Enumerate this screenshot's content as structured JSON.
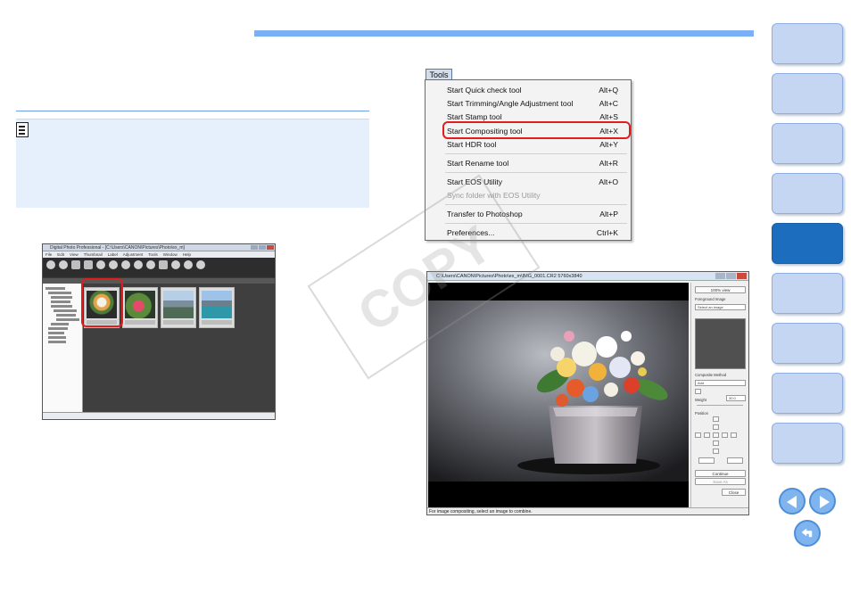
{
  "tools_menu": {
    "tab_label": "Tools",
    "items": [
      {
        "label": "Start Quick check tool",
        "shortcut": "Alt+Q"
      },
      {
        "label": "Start Trimming/Angle Adjustment tool",
        "shortcut": "Alt+C"
      },
      {
        "label": "Start Stamp tool",
        "shortcut": "Alt+S"
      },
      {
        "label": "Start Compositing tool",
        "shortcut": "Alt+X",
        "highlighted": true
      },
      {
        "label": "Start HDR tool",
        "shortcut": "Alt+Y"
      },
      {
        "label": "Start Rename tool",
        "shortcut": "Alt+R"
      },
      {
        "label": "Start EOS Utility",
        "shortcut": "Alt+O"
      },
      {
        "label": "Sync folder with EOS Utility",
        "shortcut": "",
        "disabled": true
      },
      {
        "label": "Transfer to Photoshop",
        "shortcut": "Alt+P"
      },
      {
        "label": "Preferences...",
        "shortcut": "Ctrl+K"
      }
    ]
  },
  "compositing_window": {
    "title": "C:\\Users\\CANON\\Pictures\\Photo\\ex_m\\IMG_0001.CR2  5760x3840",
    "view_button": "100% view",
    "foreground_label": "Foreground Image",
    "foreground_value": "Select an image",
    "method_label": "Composite Method",
    "method_value": "Add",
    "weight_label": "Weight",
    "weight_value": "30.0",
    "position_label": "Position",
    "continue_button": "Continue",
    "save_as_button": "Save As",
    "close_button": "Close",
    "status_text": "For image compositing, select an image to combine."
  },
  "dpp_window": {
    "title": "Digital Photo Professional - [C:\\Users\\CANON\\Pictures\\Photo\\ex_m]",
    "menu": [
      "File",
      "Edit",
      "View",
      "Thumbnail",
      "Label",
      "Adjustment",
      "Tools",
      "Window",
      "Help"
    ]
  },
  "watermark": "COPY",
  "colors": {
    "accent_band": "#7ab0f5",
    "highlight_ring": "#e01e1e",
    "nav_button": "#c5d6f3",
    "nav_button_active": "#1d6dbf"
  },
  "icons": {
    "note": "memo-icon",
    "prev": "previous-page-arrow",
    "next": "next-page-arrow",
    "back": "return-icon"
  }
}
